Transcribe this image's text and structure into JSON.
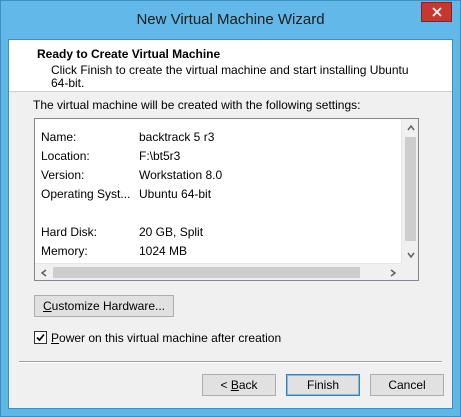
{
  "window": {
    "title": "New Virtual Machine Wizard"
  },
  "header": {
    "title": "Ready to Create Virtual Machine",
    "description": "Click Finish to create the virtual machine and start installing Ubuntu 64-bit."
  },
  "intro_text": "The virtual machine will be created with the following settings:",
  "settings": [
    {
      "label": "Name:",
      "value": "backtrack 5 r3"
    },
    {
      "label": "Location:",
      "value": "F:\\bt5r3"
    },
    {
      "label": "Version:",
      "value": "Workstation 8.0"
    },
    {
      "label": "Operating Syst...",
      "value": "Ubuntu 64-bit"
    },
    {
      "label": "Hard Disk:",
      "value": "20 GB, Split"
    },
    {
      "label": "Memory:",
      "value": "1024 MB"
    }
  ],
  "buttons": {
    "customize_pre": "",
    "customize_accel": "C",
    "customize_post": "ustomize Hardware...",
    "back_pre": "< ",
    "back_accel": "B",
    "back_post": "ack",
    "finish": "Finish",
    "cancel": "Cancel"
  },
  "power_on": {
    "checked": true,
    "label_accel": "P",
    "label_rest": "ower on this virtual machine after creation"
  },
  "icons": {
    "close": "close-icon",
    "scroll_up": "chevron-up-icon",
    "scroll_down": "chevron-down-icon",
    "scroll_left": "chevron-left-icon",
    "scroll_right": "chevron-right-icon",
    "check": "checkmark-icon"
  },
  "colors": {
    "title_bar": "#62b8e8",
    "close_button": "#c7372f"
  }
}
